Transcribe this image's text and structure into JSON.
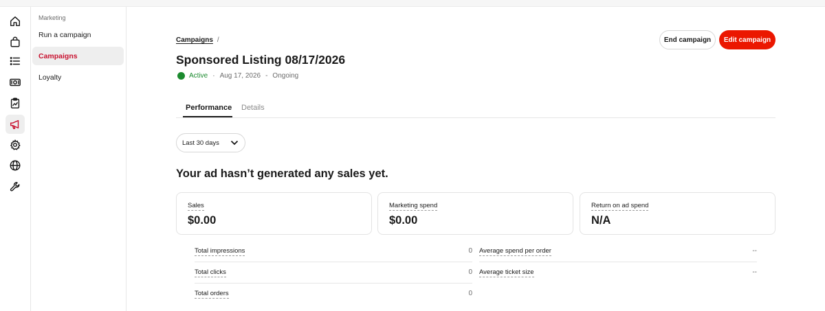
{
  "rail": {
    "items": [
      {
        "icon": "home-icon"
      },
      {
        "icon": "shopping-bag-icon"
      },
      {
        "icon": "list-icon"
      },
      {
        "icon": "money-icon"
      },
      {
        "icon": "clipboard-chart-icon"
      },
      {
        "icon": "megaphone-icon",
        "active": true
      },
      {
        "icon": "gear-icon"
      },
      {
        "icon": "globe-icon"
      },
      {
        "icon": "wrench-icon"
      }
    ]
  },
  "subnav": {
    "heading": "Marketing",
    "items": [
      {
        "label": "Run a campaign"
      },
      {
        "label": "Campaigns",
        "active": true
      },
      {
        "label": "Loyalty"
      }
    ]
  },
  "header": {
    "breadcrumb": "Campaigns",
    "breadcrumb_sep": "/",
    "title": "Sponsored Listing 08/17/2026",
    "status": "Active",
    "status_color": "#1b8a2e",
    "dot_sep": "·",
    "date": "Aug 17, 2026",
    "dash_sep": "-",
    "duration": "Ongoing",
    "end_label": "End campaign",
    "edit_label": "Edit campaign",
    "accent_color": "#eb1700"
  },
  "tabs": [
    {
      "label": "Performance",
      "active": true
    },
    {
      "label": "Details"
    }
  ],
  "date_range": {
    "selected": "Last 30 days"
  },
  "headline": "Your ad hasn’t generated any sales yet.",
  "cards": [
    {
      "label": "Sales",
      "value": "$0.00"
    },
    {
      "label": "Marketing spend",
      "value": "$0.00"
    },
    {
      "label": "Return on ad spend",
      "value": "N/A"
    }
  ],
  "metrics_left": [
    {
      "label": "Total impressions",
      "value": "0"
    },
    {
      "label": "Total clicks",
      "value": "0"
    },
    {
      "label": "Total orders",
      "value": "0"
    }
  ],
  "metrics_right": [
    {
      "label": "Average spend per order",
      "value": "--"
    },
    {
      "label": "Average ticket size",
      "value": "--"
    }
  ]
}
